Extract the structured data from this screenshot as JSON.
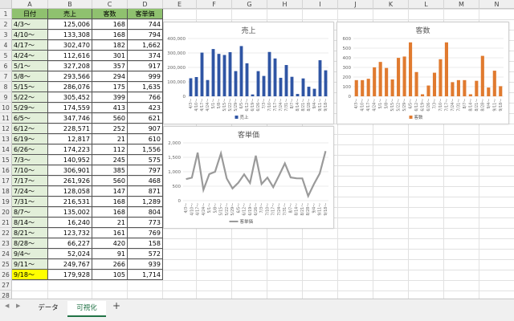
{
  "columns": [
    "A",
    "B",
    "C",
    "D",
    "E",
    "F",
    "G",
    "H",
    "I",
    "J",
    "K",
    "L",
    "M",
    "N"
  ],
  "headers": [
    "日付",
    "売上",
    "客数",
    "客単価"
  ],
  "rows": [
    [
      "4/3〜",
      "125,006",
      "168",
      "744"
    ],
    [
      "4/10〜",
      "133,308",
      "168",
      "794"
    ],
    [
      "4/17〜",
      "302,470",
      "182",
      "1,662"
    ],
    [
      "4/24〜",
      "112,616",
      "301",
      "374"
    ],
    [
      "5/1〜",
      "327,208",
      "357",
      "917"
    ],
    [
      "5/8〜",
      "293,566",
      "294",
      "999"
    ],
    [
      "5/15〜",
      "286,076",
      "175",
      "1,635"
    ],
    [
      "5/22〜",
      "305,452",
      "399",
      "766"
    ],
    [
      "5/29〜",
      "174,559",
      "413",
      "423"
    ],
    [
      "6/5〜",
      "347,746",
      "560",
      "621"
    ],
    [
      "6/12〜",
      "228,571",
      "252",
      "907"
    ],
    [
      "6/19〜",
      "12,817",
      "21",
      "610"
    ],
    [
      "6/26〜",
      "174,223",
      "112",
      "1,556"
    ],
    [
      "7/3〜",
      "140,952",
      "245",
      "575"
    ],
    [
      "7/10〜",
      "306,901",
      "385",
      "797"
    ],
    [
      "7/17〜",
      "261,926",
      "560",
      "468"
    ],
    [
      "7/24〜",
      "128,058",
      "147",
      "871"
    ],
    [
      "7/31〜",
      "216,531",
      "168",
      "1,289"
    ],
    [
      "8/7〜",
      "135,002",
      "168",
      "804"
    ],
    [
      "8/14〜",
      "16,240",
      "21",
      "773"
    ],
    [
      "8/21〜",
      "123,732",
      "161",
      "769"
    ],
    [
      "8/28〜",
      "66,227",
      "420",
      "158"
    ],
    [
      "9/4〜",
      "52,024",
      "91",
      "572"
    ],
    [
      "9/11〜",
      "249,767",
      "266",
      "939"
    ],
    [
      "9/18〜",
      "179,928",
      "105",
      "1,714"
    ]
  ],
  "tabs": [
    "データ",
    "可視化"
  ],
  "add_tab": "+",
  "nav_prev": "◀",
  "nav_next": "▶",
  "colors": {
    "header_green": "#8fc16f",
    "row_green": "#e2efd9",
    "highlight_yellow": "#ffff00",
    "bar_blue": "#2f55a4",
    "bar_orange": "#e07a2f",
    "line_gray": "#9a9a9a",
    "tab_green": "#217346"
  },
  "chart_data": [
    {
      "type": "bar",
      "title": "売上",
      "categories": [
        "4/3〜",
        "4/10〜",
        "4/17〜",
        "4/24〜",
        "5/1〜",
        "5/8〜",
        "5/15〜",
        "5/22〜",
        "5/29〜",
        "6/5〜",
        "6/12〜",
        "6/19〜",
        "6/26〜",
        "7/3〜",
        "7/10〜",
        "7/17〜",
        "7/24〜",
        "7/31〜",
        "8/7〜",
        "8/14〜",
        "8/21〜",
        "8/28〜",
        "9/4〜",
        "9/11〜",
        "9/18〜"
      ],
      "series": [
        {
          "name": "売上",
          "values": [
            125006,
            133308,
            302470,
            112616,
            327208,
            293566,
            286076,
            305452,
            174559,
            347746,
            228571,
            12817,
            174223,
            140952,
            306901,
            261926,
            128058,
            216531,
            135002,
            16240,
            123732,
            66227,
            52024,
            249767,
            179928
          ]
        }
      ],
      "yticks": [
        "0",
        "100,000",
        "200,000",
        "300,000",
        "400,000"
      ],
      "ylim": [
        0,
        400000
      ],
      "legend": "bottom"
    },
    {
      "type": "bar",
      "title": "客数",
      "categories": [
        "4/3〜",
        "4/10〜",
        "4/17〜",
        "4/24〜",
        "5/1〜",
        "5/8〜",
        "5/15〜",
        "5/22〜",
        "5/29〜",
        "6/5〜",
        "6/12〜",
        "6/19〜",
        "6/26〜",
        "7/3〜",
        "7/10〜",
        "7/17〜",
        "7/24〜",
        "7/31〜",
        "8/7〜",
        "8/14〜",
        "8/21〜",
        "8/28〜",
        "9/4〜",
        "9/11〜",
        "9/18〜"
      ],
      "series": [
        {
          "name": "客数",
          "values": [
            168,
            168,
            182,
            301,
            357,
            294,
            175,
            399,
            413,
            560,
            252,
            21,
            112,
            245,
            385,
            560,
            147,
            168,
            168,
            21,
            161,
            420,
            91,
            266,
            105
          ]
        }
      ],
      "yticks": [
        "0",
        "100",
        "200",
        "300",
        "400",
        "500",
        "600"
      ],
      "ylim": [
        0,
        600
      ],
      "legend": "bottom"
    },
    {
      "type": "line",
      "title": "客単価",
      "categories": [
        "4/3〜",
        "4/10〜",
        "4/17〜",
        "4/24〜",
        "5/1〜",
        "5/8〜",
        "5/15〜",
        "5/22〜",
        "5/29〜",
        "6/5〜",
        "6/12〜",
        "6/19〜",
        "6/26〜",
        "7/3〜",
        "7/10〜",
        "7/17〜",
        "7/24〜",
        "7/31〜",
        "8/7〜",
        "8/14〜",
        "8/21〜",
        "8/28〜",
        "9/4〜",
        "9/11〜",
        "9/18〜"
      ],
      "series": [
        {
          "name": "客単価",
          "values": [
            744,
            794,
            1662,
            374,
            917,
            999,
            1635,
            766,
            423,
            621,
            907,
            610,
            1556,
            575,
            797,
            468,
            871,
            1289,
            804,
            773,
            769,
            158,
            572,
            939,
            1714
          ]
        }
      ],
      "yticks": [
        "0",
        "500",
        "1,000",
        "1,500",
        "2,000"
      ],
      "ylim": [
        0,
        2000
      ],
      "legend": "bottom"
    }
  ]
}
